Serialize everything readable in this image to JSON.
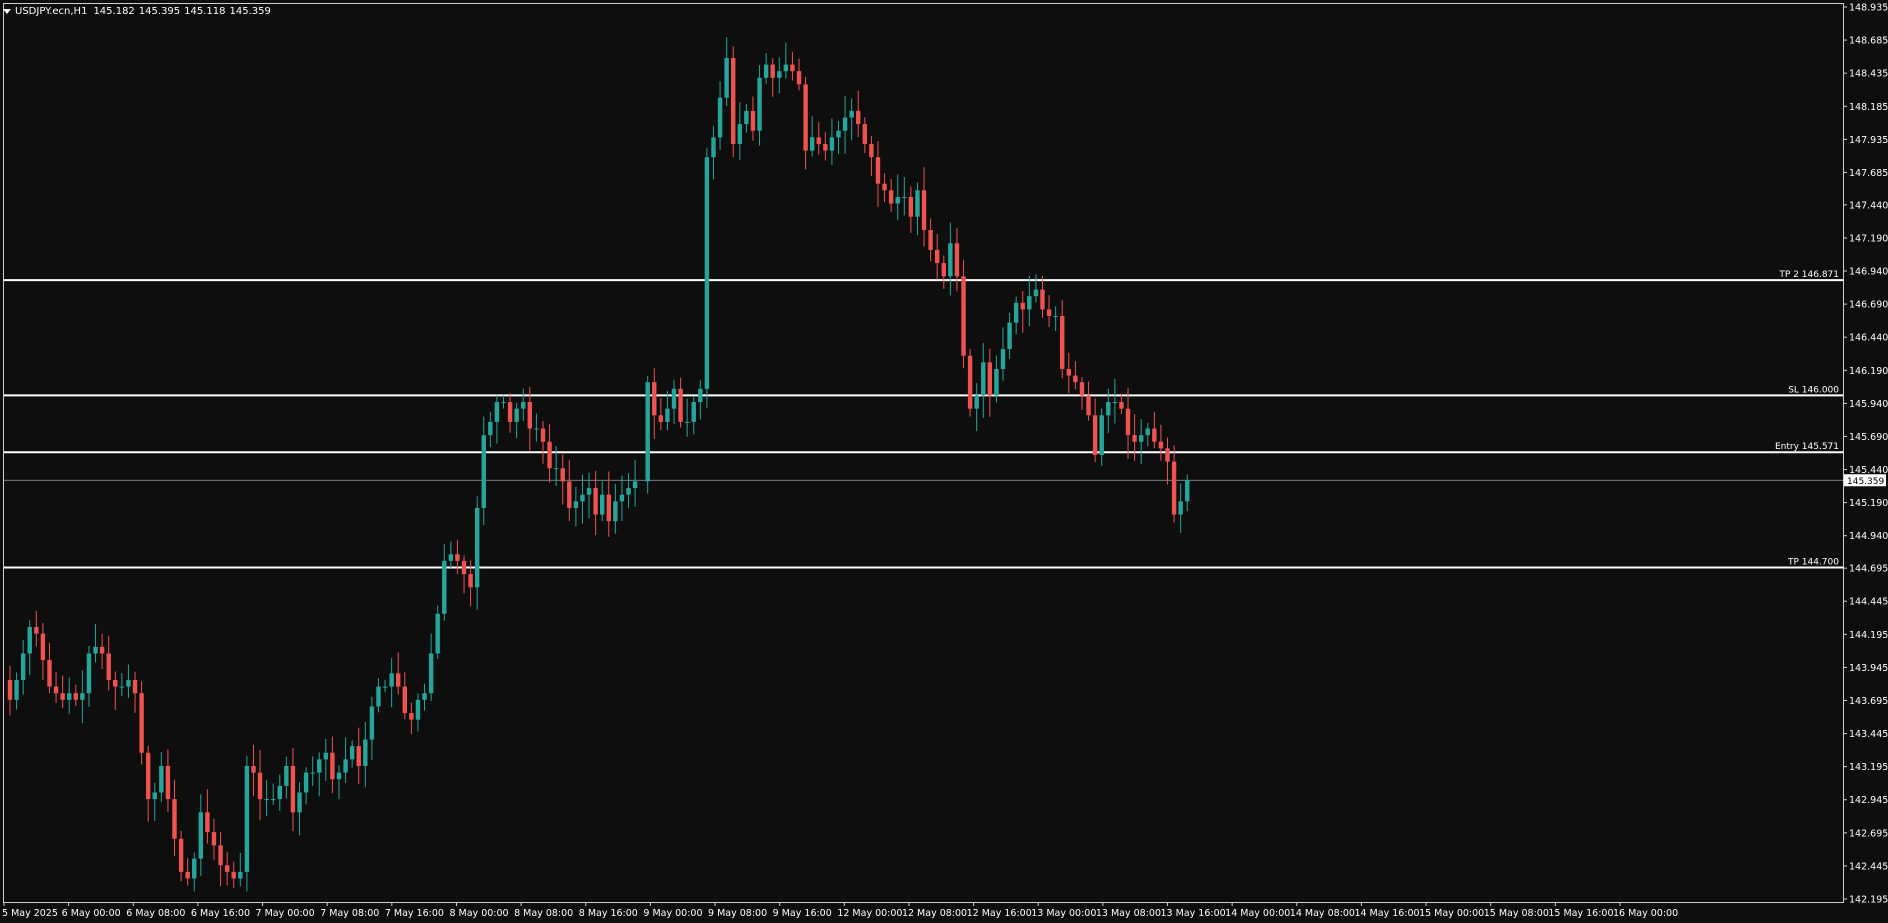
{
  "symbol": "USDJPY.ecn,H1",
  "ohlc": {
    "open": "145.182",
    "high": "145.395",
    "low": "145.118",
    "close": "145.359"
  },
  "colors": {
    "background": "#0e0e0e",
    "bull": "#26a69a",
    "bear": "#ef5350",
    "level_line": "#ffffff",
    "bid_line": "#9aa0a6",
    "text": "#ffffff"
  },
  "chart_data": {
    "type": "candlestick",
    "symbol": "USDJPY.ecn",
    "timeframe": "H1",
    "ylim": [
      142.2,
      148.95
    ],
    "y_ticks": [
      "148.935",
      "148.685",
      "148.435",
      "148.185",
      "147.935",
      "147.685",
      "147.440",
      "147.190",
      "146.940",
      "146.690",
      "146.440",
      "146.190",
      "145.940",
      "145.690",
      "145.440",
      "145.190",
      "144.940",
      "144.695",
      "144.445",
      "144.195",
      "143.945",
      "143.695",
      "143.445",
      "143.195",
      "142.945",
      "142.695",
      "142.445",
      "142.195"
    ],
    "x_ticks": [
      "5 May 2025",
      "6 May 00:00",
      "6 May 08:00",
      "6 May 16:00",
      "7 May 00:00",
      "7 May 08:00",
      "7 May 16:00",
      "8 May 00:00",
      "8 May 08:00",
      "8 May 16:00",
      "9 May 00:00",
      "9 May 08:00",
      "9 May 16:00",
      "12 May 00:00",
      "12 May 08:00",
      "12 May 16:00",
      "13 May 00:00",
      "13 May 08:00",
      "13 May 16:00",
      "14 May 00:00",
      "14 May 08:00",
      "14 May 16:00",
      "15 May 00:00",
      "15 May 08:00",
      "15 May 16:00",
      "16 May 00:00"
    ],
    "current_price": "145.359",
    "levels": [
      {
        "label": "TP 2 146.871",
        "value": 146.871
      },
      {
        "label": "SL 146.000",
        "value": 146.0
      },
      {
        "label": "Entry 145.571",
        "value": 145.571
      },
      {
        "label": "TP 144.700",
        "value": 144.7
      }
    ],
    "closes": [
      143.7,
      143.85,
      144.05,
      144.25,
      144.2,
      144.0,
      143.8,
      143.75,
      143.7,
      143.75,
      143.7,
      143.75,
      144.05,
      144.1,
      144.05,
      143.85,
      143.8,
      143.8,
      143.85,
      143.75,
      143.3,
      142.95,
      143.0,
      143.2,
      142.95,
      142.65,
      142.4,
      142.35,
      142.5,
      142.85,
      142.7,
      142.6,
      142.45,
      142.4,
      142.35,
      142.4,
      143.2,
      143.15,
      142.95,
      142.95,
      142.95,
      143.05,
      143.2,
      142.85,
      143.0,
      143.15,
      143.15,
      143.25,
      143.3,
      143.1,
      143.15,
      143.25,
      143.35,
      143.2,
      143.4,
      143.65,
      143.8,
      143.8,
      143.9,
      143.8,
      143.6,
      143.55,
      143.7,
      143.75,
      144.05,
      144.35,
      144.75,
      144.8,
      144.75,
      144.65,
      144.55,
      145.15,
      145.7,
      145.8,
      145.95,
      145.95,
      145.8,
      145.9,
      145.95,
      145.75,
      145.75,
      145.65,
      145.45,
      145.45,
      145.35,
      145.15,
      145.2,
      145.25,
      145.3,
      145.1,
      145.25,
      145.05,
      145.2,
      145.25,
      145.3,
      145.35,
      146.1,
      145.85,
      145.8,
      145.9,
      146.05,
      145.8,
      145.8,
      145.95,
      146.05,
      147.8,
      147.95,
      148.25,
      148.55,
      147.9,
      148.05,
      148.15,
      148.0,
      148.4,
      148.5,
      148.4,
      148.45,
      148.5,
      148.45,
      148.35,
      147.85,
      147.95,
      147.9,
      147.85,
      147.95,
      148.0,
      148.1,
      148.15,
      148.05,
      147.9,
      147.8,
      147.6,
      147.55,
      147.45,
      147.5,
      147.5,
      147.35,
      147.55,
      147.25,
      147.1,
      147.0,
      146.9,
      147.15,
      146.9,
      146.3,
      145.9,
      146.0,
      146.25,
      146.0,
      146.2,
      146.35,
      146.55,
      146.7,
      146.65,
      146.75,
      146.8,
      146.65,
      146.6,
      146.6,
      146.2,
      146.15,
      146.1,
      146.0,
      145.85,
      145.55,
      145.85,
      145.95,
      145.95,
      145.9,
      145.7,
      145.65,
      145.7,
      145.75,
      145.65,
      145.6,
      145.5,
      145.1,
      145.2,
      145.36
    ],
    "rendering": "candles synthesized from closes; body/wick extents approximate"
  }
}
